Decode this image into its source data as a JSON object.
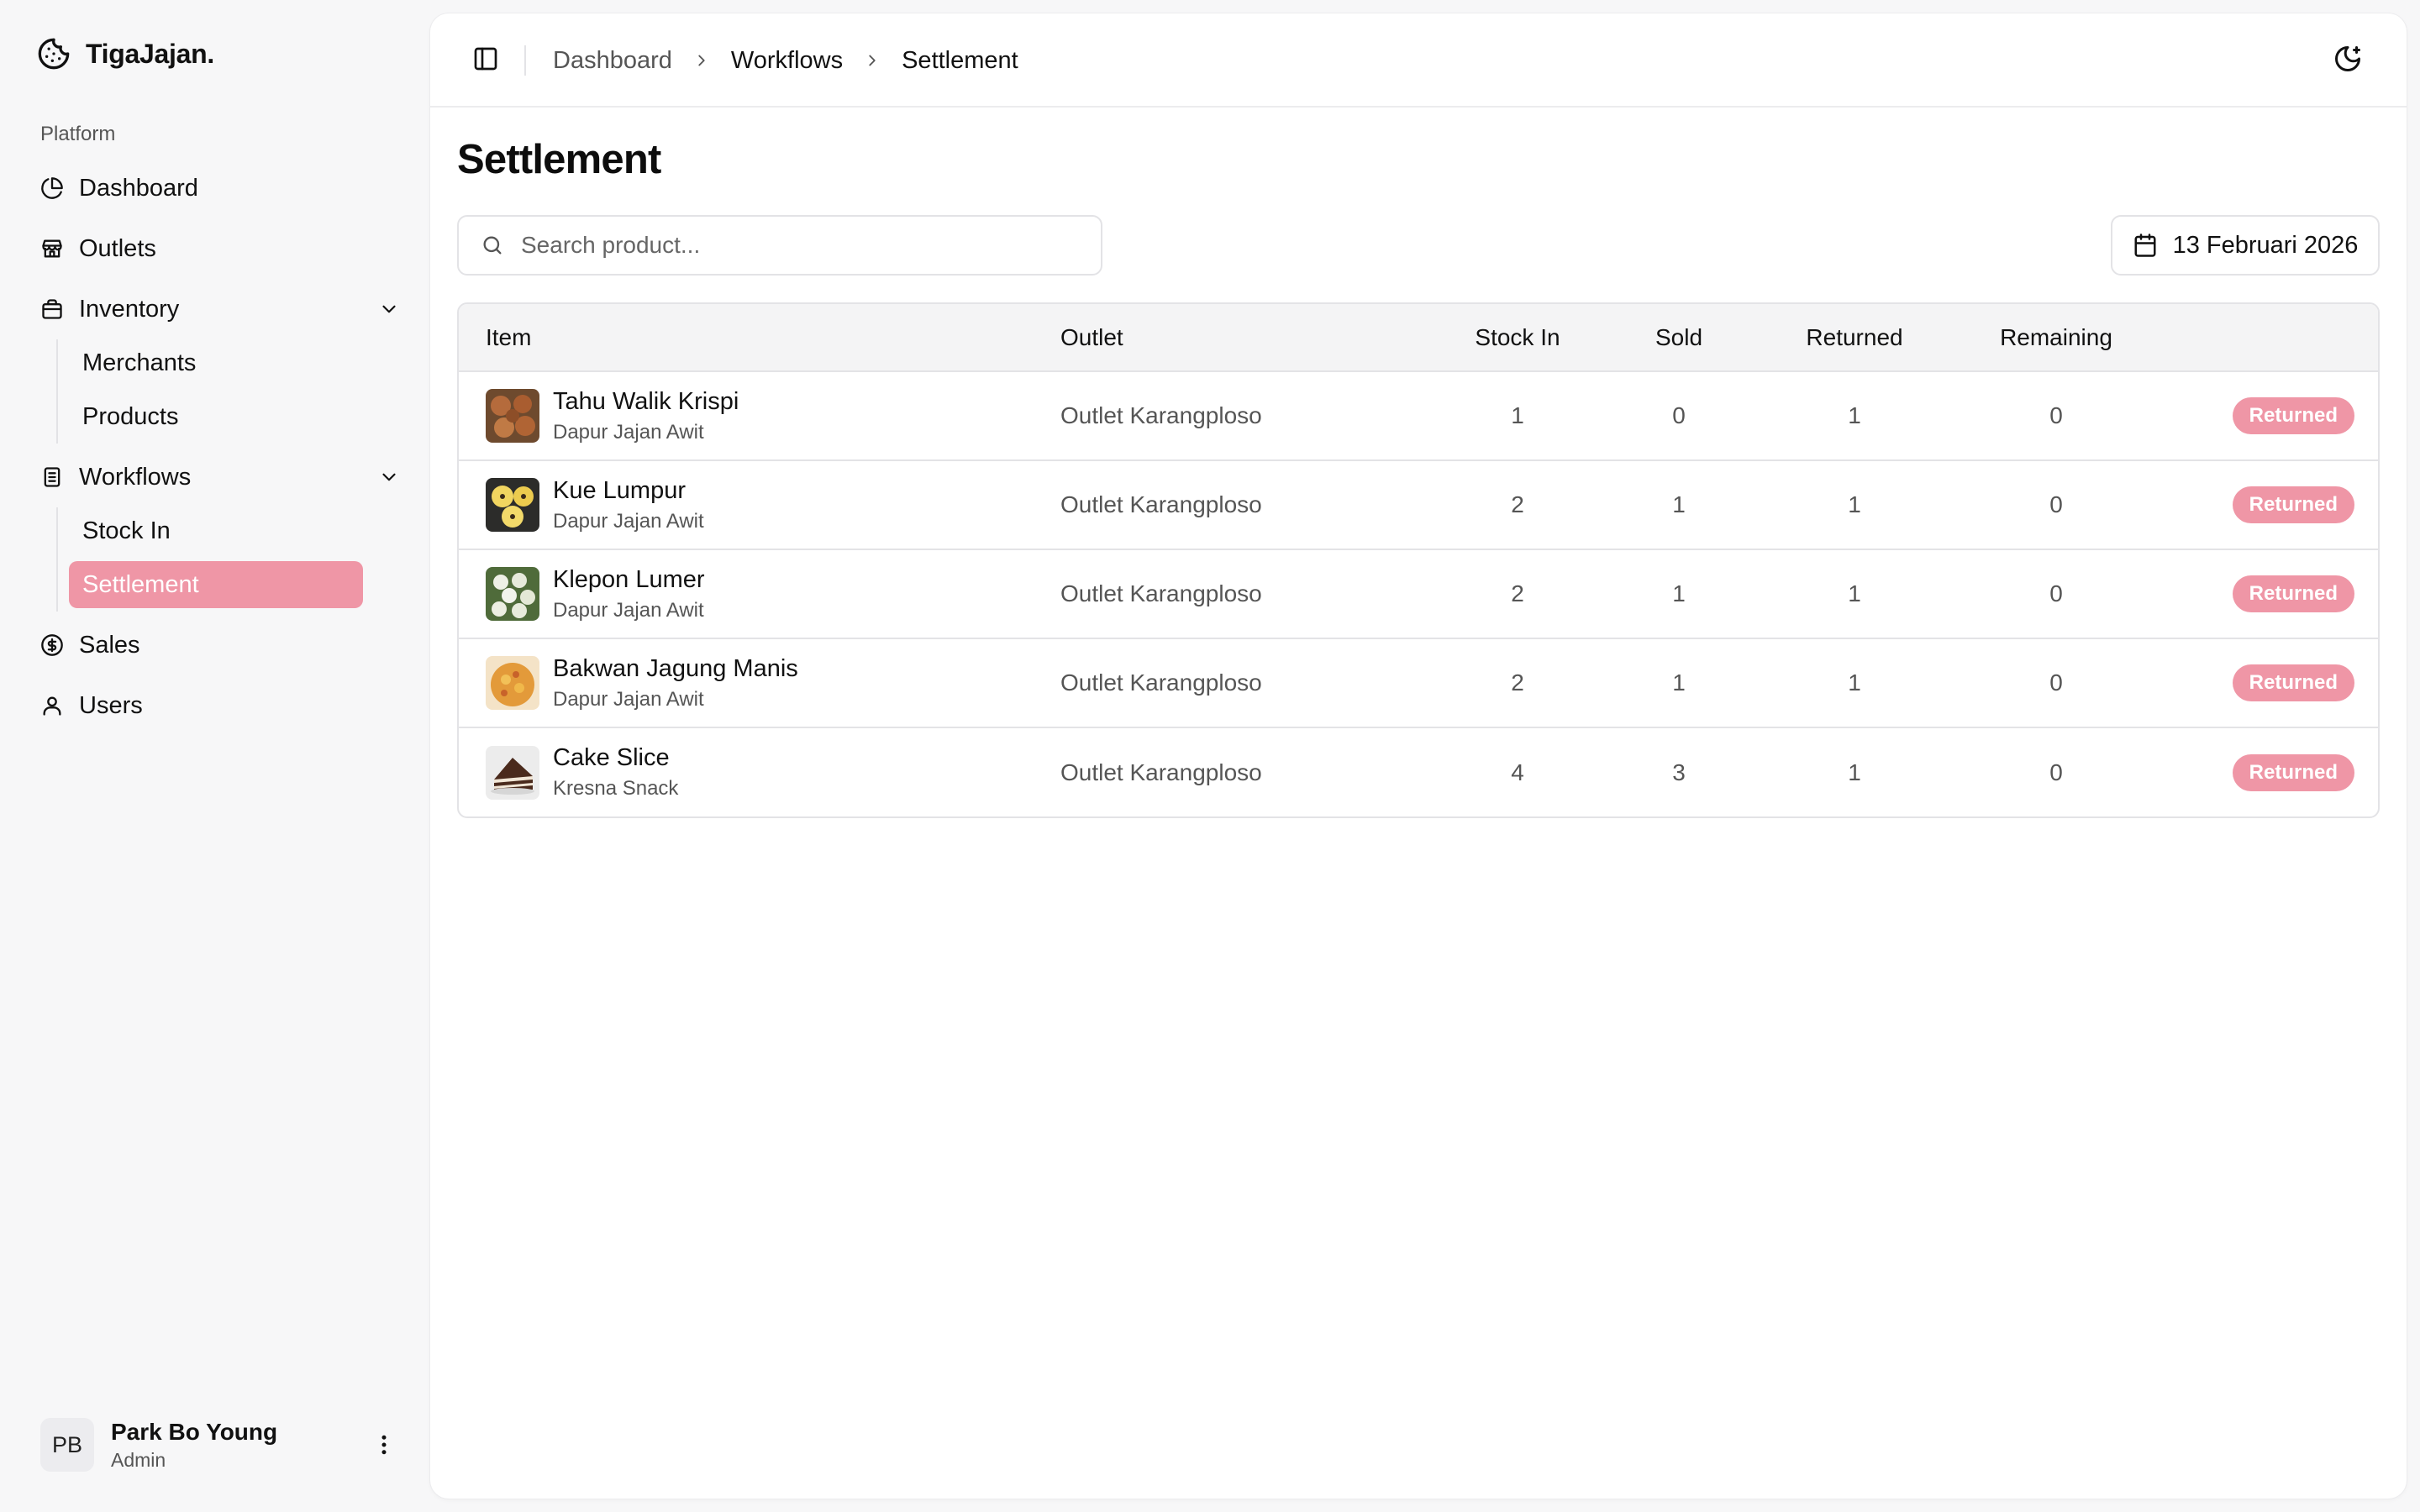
{
  "app": {
    "name": "TigaJajan."
  },
  "sidebar": {
    "group_label": "Platform",
    "items": {
      "dashboard": "Dashboard",
      "outlets": "Outlets",
      "inventory": "Inventory",
      "merchants": "Merchants",
      "products": "Products",
      "workflows": "Workflows",
      "stock_in": "Stock In",
      "settlement": "Settlement",
      "sales": "Sales",
      "users": "Users"
    },
    "active_item": "Settlement"
  },
  "user": {
    "initials": "PB",
    "name": "Park Bo Young",
    "role": "Admin"
  },
  "breadcrumb": [
    "Dashboard",
    "Workflows",
    "Settlement"
  ],
  "page": {
    "title": "Settlement"
  },
  "search": {
    "placeholder": "Search product...",
    "value": ""
  },
  "date_filter": {
    "label": "13 Februari 2026"
  },
  "table": {
    "columns": [
      "Item",
      "Outlet",
      "Stock In",
      "Sold",
      "Returned",
      "Remaining",
      ""
    ],
    "rows": [
      {
        "name": "Tahu Walik Krispi",
        "merchant": "Dapur Jajan Awit",
        "outlet": "Outlet Karangploso",
        "stock_in": "1",
        "sold": "0",
        "returned": "1",
        "remaining": "0",
        "status": "Returned",
        "thumb": "tahu-walik-photo"
      },
      {
        "name": "Kue Lumpur",
        "merchant": "Dapur Jajan Awit",
        "outlet": "Outlet Karangploso",
        "stock_in": "2",
        "sold": "1",
        "returned": "1",
        "remaining": "0",
        "status": "Returned",
        "thumb": "kue-lumpur-photo"
      },
      {
        "name": "Klepon Lumer",
        "merchant": "Dapur Jajan Awit",
        "outlet": "Outlet Karangploso",
        "stock_in": "2",
        "sold": "1",
        "returned": "1",
        "remaining": "0",
        "status": "Returned",
        "thumb": "klepon-photo"
      },
      {
        "name": "Bakwan Jagung Manis",
        "merchant": "Dapur Jajan Awit",
        "outlet": "Outlet Karangploso",
        "stock_in": "2",
        "sold": "1",
        "returned": "1",
        "remaining": "0",
        "status": "Returned",
        "thumb": "bakwan-photo"
      },
      {
        "name": "Cake Slice",
        "merchant": "Kresna Snack",
        "outlet": "Outlet Karangploso",
        "stock_in": "4",
        "sold": "3",
        "returned": "1",
        "remaining": "0",
        "status": "Returned",
        "thumb": "cake-slice-photo"
      }
    ]
  },
  "colors": {
    "accent": "#ef96a6",
    "muted_text": "#555555",
    "border": "#e3e3e6",
    "background": "#f7f7f8"
  }
}
